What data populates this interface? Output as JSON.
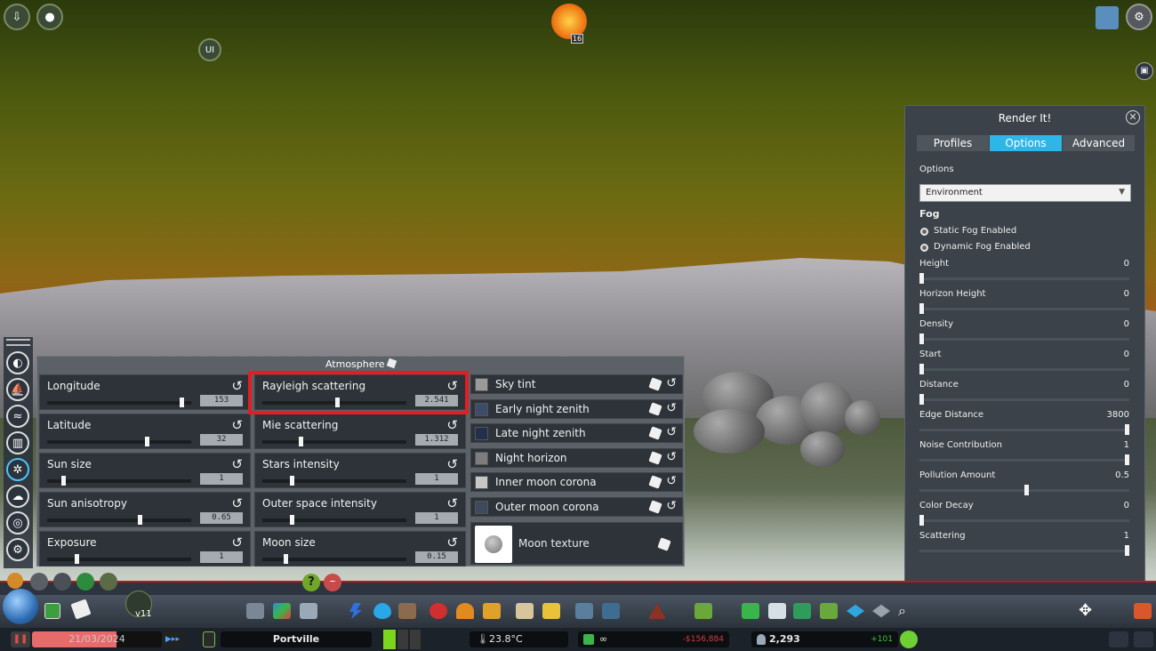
{
  "top_hud": {
    "event_badge": "16",
    "ui_badge": "UI"
  },
  "atmosphere": {
    "title": "Atmosphere",
    "sliders_left": [
      {
        "label": "Longitude",
        "value": "153",
        "fraction": 0.95
      },
      {
        "label": "Latitude",
        "value": "32",
        "fraction": 0.7
      },
      {
        "label": "Sun size",
        "value": "1",
        "fraction": 0.1
      },
      {
        "label": "Sun anisotropy",
        "value": "0.65",
        "fraction": 0.65
      },
      {
        "label": "Exposure",
        "value": "1",
        "fraction": 0.2
      }
    ],
    "sliders_mid": [
      {
        "label": "Rayleigh scattering",
        "value": "2.541",
        "fraction": 0.52
      },
      {
        "label": "Mie scattering",
        "value": "1.312",
        "fraction": 0.26
      },
      {
        "label": "Stars intensity",
        "value": "1",
        "fraction": 0.2
      },
      {
        "label": "Outer space intensity",
        "value": "1",
        "fraction": 0.2
      },
      {
        "label": "Moon size",
        "value": "0.15",
        "fraction": 0.15
      }
    ],
    "colors": [
      {
        "label": "Sky tint",
        "color": "#9a9a9a"
      },
      {
        "label": "Early night zenith",
        "color": "#3c4d6a"
      },
      {
        "label": "Late night zenith",
        "color": "#22304d"
      },
      {
        "label": "Night horizon",
        "color": "#7d7d7d"
      },
      {
        "label": "Inner moon corona",
        "color": "#c7c7c7"
      },
      {
        "label": "Outer moon corona",
        "color": "#3d4a5e"
      }
    ],
    "moon_texture_label": "Moon texture"
  },
  "render_it": {
    "title": "Render It!",
    "tabs": [
      "Profiles",
      "Options",
      "Advanced"
    ],
    "active_tab": "Options",
    "options_label": "Options",
    "dropdown_value": "Environment",
    "section": "Fog",
    "radios": [
      "Static Fog Enabled",
      "Dynamic Fog Enabled"
    ],
    "sliders": [
      {
        "label": "Height",
        "value": "0",
        "fraction": 0
      },
      {
        "label": "Horizon Height",
        "value": "0",
        "fraction": 0
      },
      {
        "label": "Density",
        "value": "0",
        "fraction": 0
      },
      {
        "label": "Start",
        "value": "0",
        "fraction": 0
      },
      {
        "label": "Distance",
        "value": "0",
        "fraction": 0
      },
      {
        "label": "Edge Distance",
        "value": "3800",
        "fraction": 1
      },
      {
        "label": "Noise Contribution",
        "value": "1",
        "fraction": 1
      },
      {
        "label": "Pollution Amount",
        "value": "0.5",
        "fraction": 0.5
      },
      {
        "label": "Color Decay",
        "value": "0",
        "fraction": 0
      },
      {
        "label": "Scattering",
        "value": "1",
        "fraction": 1
      }
    ]
  },
  "toolbar": {
    "version": "v11"
  },
  "status": {
    "date": "21/03/2024",
    "city": "Portville",
    "temperature": "23.8°C",
    "infinity": "∞",
    "money": "-$156,884",
    "population": "2,293",
    "pop_change": "+101"
  },
  "colors": {
    "accent_red": "#e41c26",
    "active_tab": "#2fb6e8",
    "status_green": "#6fcf33"
  }
}
